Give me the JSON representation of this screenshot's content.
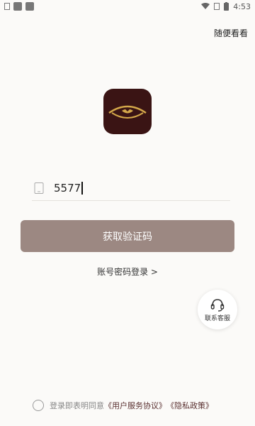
{
  "status_bar": {
    "time": "4:53",
    "icons": [
      "sim-icon",
      "app-icon",
      "app-icon",
      "wifi-icon",
      "no-sim-icon",
      "battery-icon"
    ]
  },
  "header": {
    "skip_label": "随便看看"
  },
  "phone_input": {
    "value": "5577",
    "icon": "phone-icon"
  },
  "get_code_button": {
    "label": "获取验证码",
    "color": "#9c8882"
  },
  "password_login": {
    "label": "账号密码登录 >"
  },
  "customer_service": {
    "label": "联系客服",
    "icon": "headset-icon"
  },
  "agreement": {
    "prefix": "登录即表明同意",
    "user_agreement": "《用户服务协议》",
    "privacy_policy": "《隐私政策》"
  },
  "colors": {
    "logo_bg": "#3a1414",
    "logo_gold": "#d4a84a",
    "accent_text": "#5a3030"
  }
}
